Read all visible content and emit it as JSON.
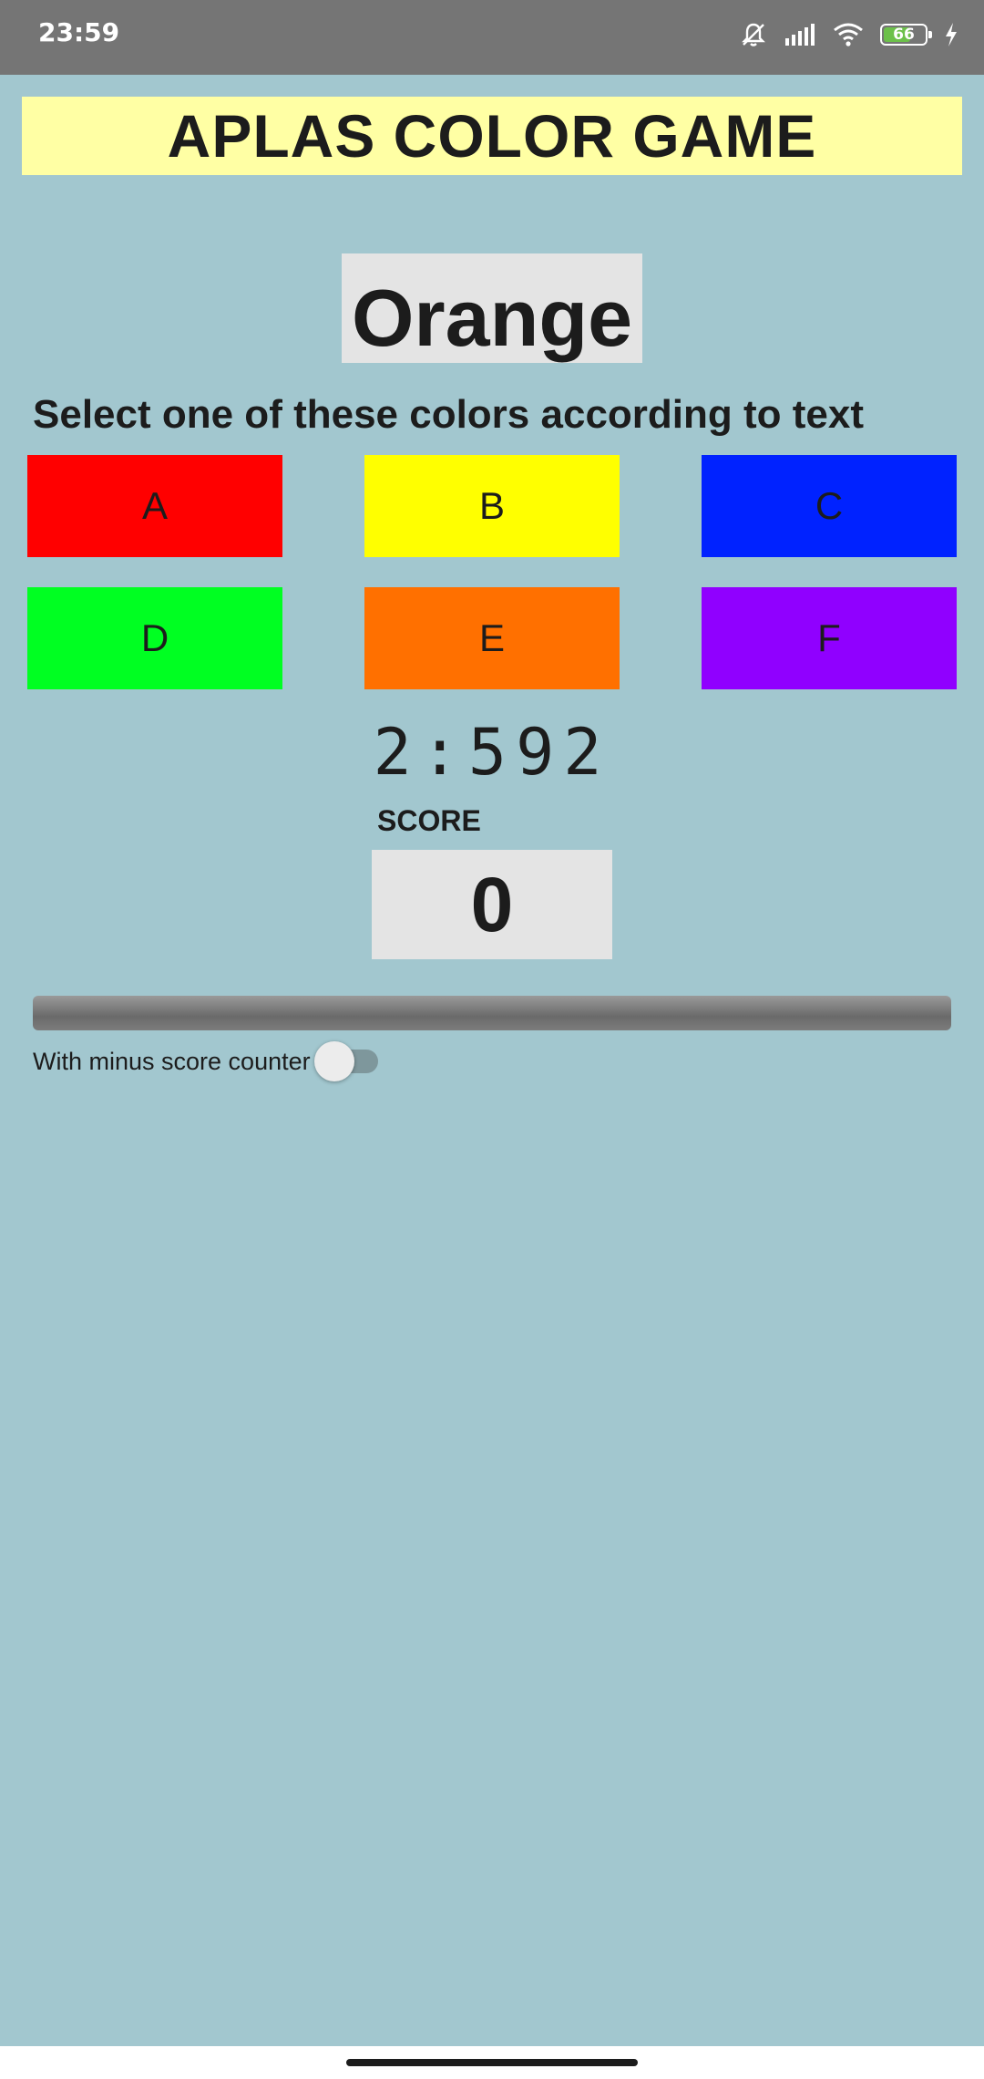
{
  "status_bar": {
    "time": "23:59",
    "icons": [
      "bell-off-icon",
      "signal-icon",
      "wifi-icon",
      "battery-icon",
      "charging-icon"
    ],
    "battery_level": "66",
    "battery_fraction": 0.66,
    "battery_color": "#6cc04a"
  },
  "header": {
    "title": "APLAS COLOR GAME",
    "background": "#ffffa4"
  },
  "game": {
    "color_word": "Orange",
    "instruction": "Select one of these colors according to text",
    "options": [
      {
        "label": "A",
        "color": "#ff0000"
      },
      {
        "label": "B",
        "color": "#ffff00"
      },
      {
        "label": "C",
        "color": "#0022ff"
      },
      {
        "label": "D",
        "color": "#00ff22"
      },
      {
        "label": "E",
        "color": "#ff7000"
      },
      {
        "label": "F",
        "color": "#9000ff"
      }
    ],
    "timer": "2:592",
    "score_label": "SCORE",
    "score": "0",
    "progress_fraction": 0
  },
  "settings": {
    "minus_score_label": "With minus score counter",
    "minus_score_enabled": false
  },
  "colors": {
    "background": "#a2c7cf",
    "panel": "#e4e4e4"
  }
}
